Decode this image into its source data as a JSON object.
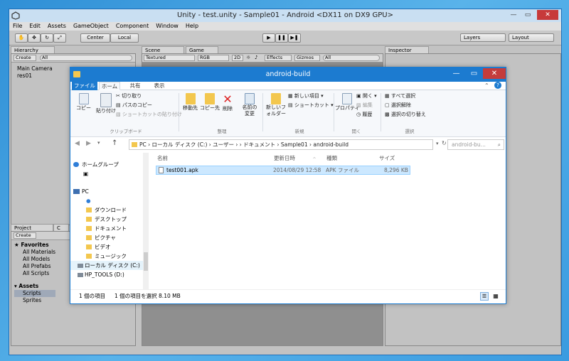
{
  "unity": {
    "title": "Unity - test.unity - Sample01 - Android <DX11 on DX9 GPU>",
    "menu": [
      "File",
      "Edit",
      "Assets",
      "GameObject",
      "Component",
      "Window",
      "Help"
    ],
    "toolbar": {
      "center": "Center",
      "local": "Local",
      "layers": "Layers",
      "layout": "Layout"
    },
    "hierarchy": {
      "tab": "Hierarchy",
      "create": "Create",
      "search": "All",
      "items": [
        "Main Camera",
        "res01"
      ]
    },
    "scene": {
      "tab": "Scene",
      "game_tab": "Game",
      "textured": "Textured",
      "rgb": "RGB",
      "mode2d": "2D",
      "effects": "Effects",
      "gizmos": "Gizmos",
      "search": "All"
    },
    "inspector": {
      "tab": "Inspector"
    },
    "project": {
      "tab": "Project",
      "tab2": "C",
      "create": "Create",
      "search": "As",
      "favorites": "Favorites",
      "fav_items": [
        "All Materials",
        "All Models",
        "All Prefabs",
        "All Scripts"
      ],
      "assets": "Assets",
      "asset_items": [
        "Scripts",
        "Sprites"
      ]
    }
  },
  "explorer": {
    "title": "android-build",
    "tabs": [
      "ファイル",
      "ホーム",
      "共有",
      "表示"
    ],
    "ribbon": {
      "copy": "コピー",
      "paste": "貼り付け",
      "cut": "切り取り",
      "copy_path": "パスのコピー",
      "paste_shortcut": "ショートカットの貼り付け",
      "clipboard": "クリップボード",
      "move_to": "移動先",
      "copy_to": "コピー先",
      "delete": "削除",
      "rename": "名前の変更",
      "organize": "整理",
      "new_folder": "新しいフォルダー",
      "new_item": "新しい項目",
      "shortcut": "ショートカット",
      "new_group": "新規",
      "properties": "プロパティ",
      "open": "開く",
      "edit": "編集",
      "history": "履歴",
      "open_group": "開く",
      "select_all": "すべて選択",
      "select_none": "選択解除",
      "invert": "選択の切り替え",
      "select_group": "選択"
    },
    "address": "PC  ›  ローカル ディスク (C:)  ›  ユーザー  ›              ›  ドキュメント  ›  Sample01  ›  android-build",
    "search_placeholder": "android-bu...",
    "nav": {
      "homegroup": "ホームグループ",
      "pc": "PC",
      "items": [
        "ダウンロード",
        "デスクトップ",
        "ドキュメント",
        "ピクチャ",
        "ビデオ",
        "ミュージック",
        "ローカル ディスク (C:)",
        "HP_TOOLS (D:)"
      ]
    },
    "columns": [
      "名前",
      "更新日時",
      "種類",
      "サイズ"
    ],
    "files": [
      {
        "name": "test001.apk",
        "date": "2014/08/29 12:58",
        "type": "APK ファイル",
        "size": "8,296 KB"
      }
    ],
    "status": {
      "count": "1 個の項目",
      "selected": "1 個の項目を選択  8.10 MB"
    }
  }
}
